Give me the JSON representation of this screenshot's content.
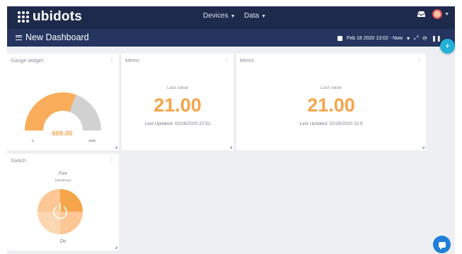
{
  "header": {
    "logo_text": "ubidots",
    "nav": [
      {
        "label": "Devices"
      },
      {
        "label": "Data"
      }
    ]
  },
  "dashboard": {
    "title": "New Dashboard",
    "date_range": "Feb 18 2020 13:02 - Now"
  },
  "widgets": {
    "gauge": {
      "title": "Gauge widget",
      "value": "609.00",
      "min": "0",
      "max": "1000",
      "fill_fraction": 0.609,
      "fill_color": "#f9ad5a",
      "track_color": "#d1d1d1"
    },
    "metric1": {
      "title": "Metric",
      "label": "Last value",
      "value": "21.00",
      "updated": "Last Updated: 02/26/2020 22:51"
    },
    "metric2": {
      "title": "Metric",
      "label": "Last value",
      "value": "21.00",
      "updated": "Last Updated: 02/26/2020 22:5"
    },
    "switch": {
      "title": "Switch",
      "off_label": "Fire",
      "off_sub": "(Incidence)",
      "on_label": "On",
      "state": "on"
    }
  },
  "colors": {
    "topbar": "#1e2a4c",
    "subbar": "#25355f",
    "accent_orange": "#f6a54a",
    "fab": "#21b0d8",
    "chat": "#1f7fd6"
  }
}
